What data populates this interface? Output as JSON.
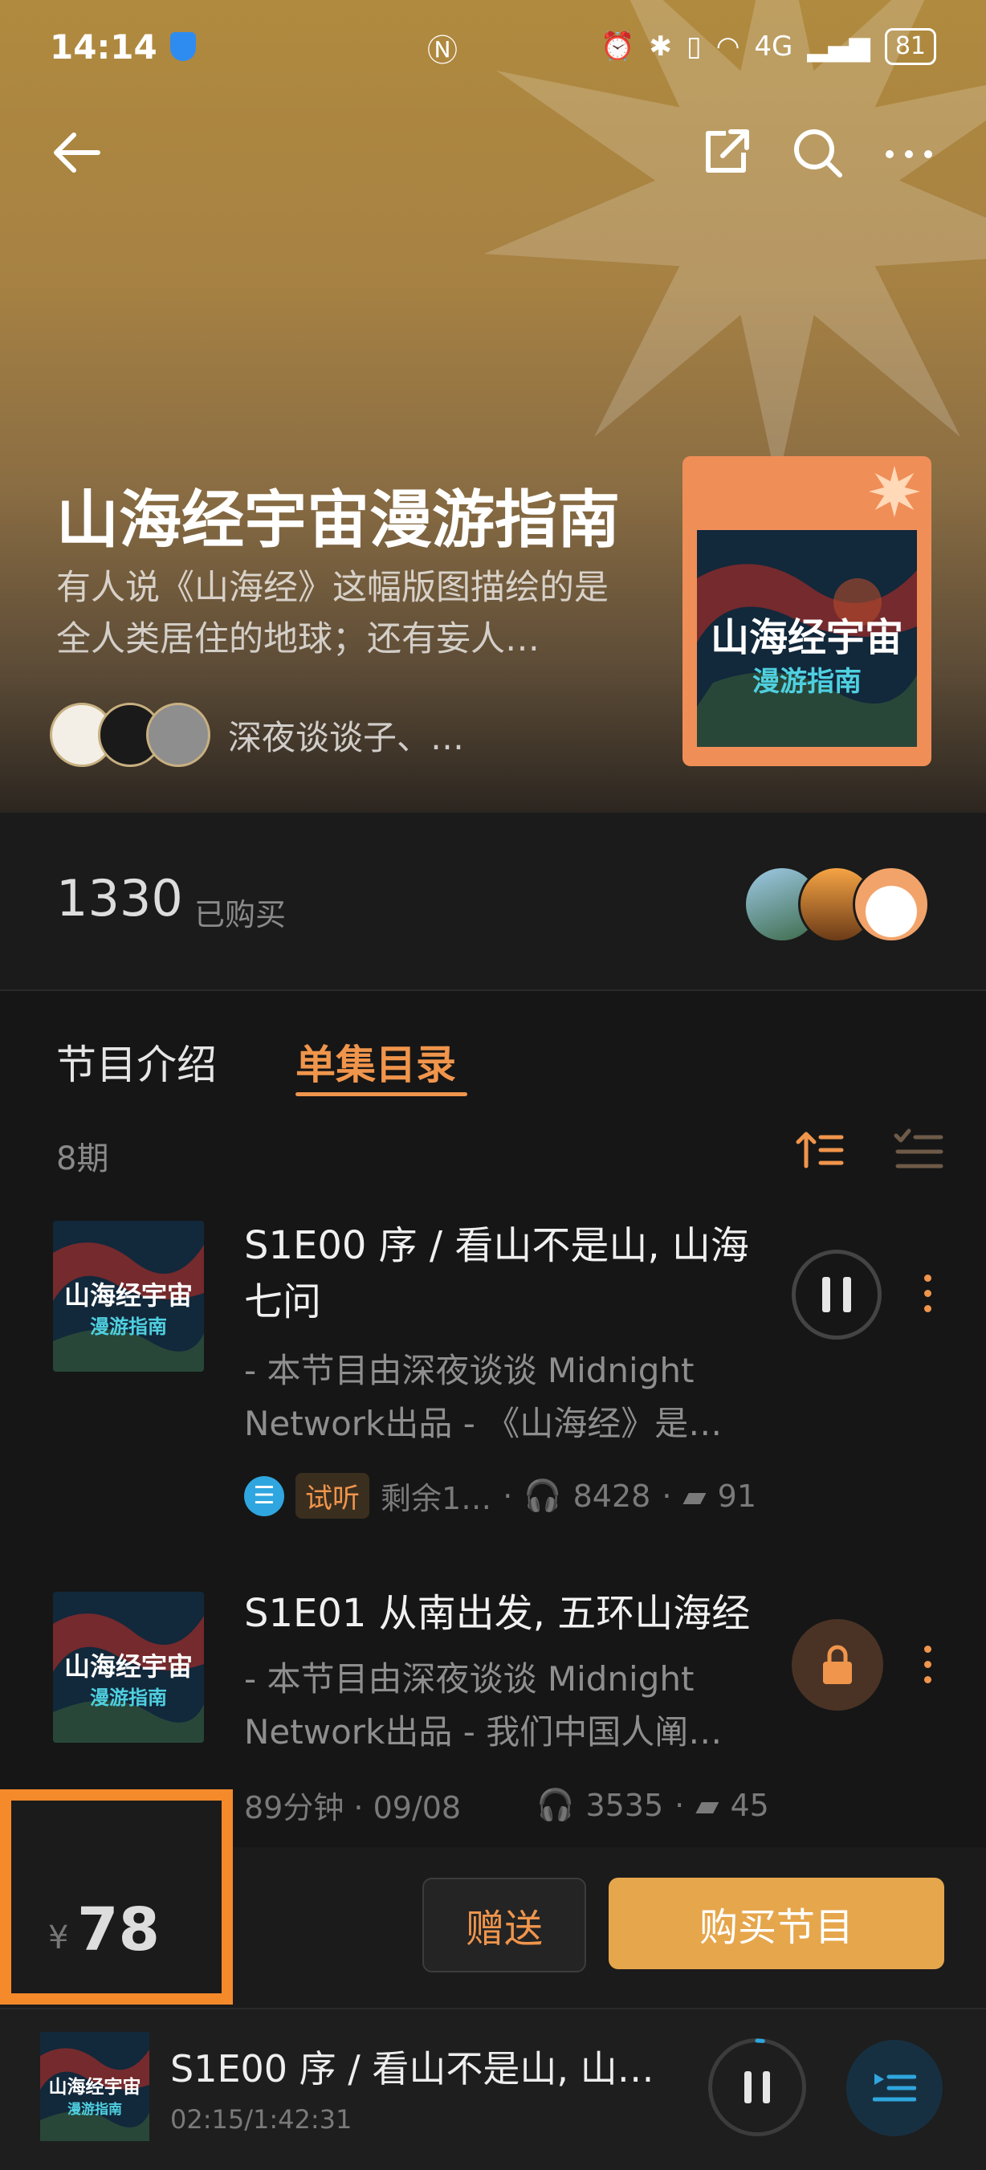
{
  "status_bar": {
    "time": "14:14",
    "network_label": "4G",
    "battery": "81"
  },
  "header": {
    "title": "山海经宇宙漫游指南",
    "description": "有人说《山海经》这幅版图描绘的是全人类居住的地球；还有妄人…",
    "authors": "深夜谈谈子、…",
    "cover_title": "山海经宇宙",
    "cover_subtitle": "漫游指南"
  },
  "stats": {
    "purchased_count": "1330",
    "purchased_label": "已购买"
  },
  "tabs": [
    {
      "label": "节目介绍",
      "active": false
    },
    {
      "label": "单集目录",
      "active": true
    }
  ],
  "episode_count": "8期",
  "episodes": [
    {
      "title": "S1E00 序 / 看山不是山, 山海七问",
      "description": "- 本节目由深夜谈谈 Midnight Network出品 - 《山海经》是…",
      "trial_tag": "试听",
      "remaining": "剩余1…",
      "plays": "8428",
      "comments": "91",
      "state": "playing"
    },
    {
      "title": "S1E01 从南出发, 五环山海经",
      "description": "- 本节目由深夜谈谈 Midnight Network出品 - 我们中国人阐…",
      "duration_date": "89分钟 · 09/08",
      "plays": "3535",
      "comments": "45",
      "state": "locked"
    }
  ],
  "purchase": {
    "currency": "¥",
    "price": "78",
    "gift_label": "赠送",
    "buy_label": "购买节目"
  },
  "mini_player": {
    "title": "S1E00 序 / 看山不是山, 山海…",
    "time": "02:15/1:42:31",
    "progress": 0.02
  },
  "colors": {
    "accent": "#f0954c",
    "buy_button": "#e6a64c",
    "highlight_box": "#f58a2b",
    "trial_badge_bg": "#3a2e1f"
  }
}
